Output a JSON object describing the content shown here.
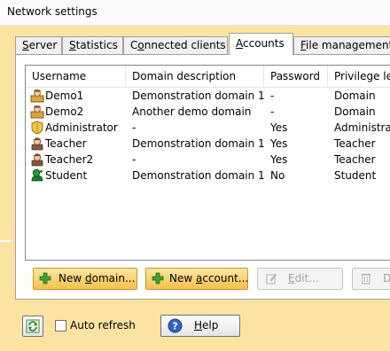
{
  "window": {
    "title": "Network settings"
  },
  "tabs": [
    {
      "label": "Server",
      "hotkey": "S",
      "rest": "erver"
    },
    {
      "label": "Statistics",
      "hotkey": "S",
      "rest": "tatistics"
    },
    {
      "label": "Connected clients",
      "pre": "C",
      "hotkey": "o",
      "rest": "nnected clients"
    },
    {
      "label": "Accounts",
      "hotkey": "A",
      "rest": "ccounts"
    },
    {
      "label": "File management",
      "hotkey": "F",
      "rest": "ile management"
    }
  ],
  "list": {
    "columns": [
      "Username",
      "Domain description",
      "Password",
      "Privilege lev"
    ],
    "rows": [
      {
        "icon": "user-domain-icon",
        "username": "Demo1",
        "domain": "Demonstration domain 1",
        "password": "-",
        "privilege": "Domain"
      },
      {
        "icon": "user-domain-icon",
        "username": "Demo2",
        "domain": "Another demo domain",
        "password": "-",
        "privilege": "Domain"
      },
      {
        "icon": "shield-admin-icon",
        "username": "Administrator",
        "domain": "-",
        "password": "Yes",
        "privilege": "Administrator"
      },
      {
        "icon": "teacher-icon",
        "username": "Teacher",
        "domain": "Demonstration domain 1",
        "password": "Yes",
        "privilege": "Teacher"
      },
      {
        "icon": "teacher-icon",
        "username": "Teacher2",
        "domain": "-",
        "password": "Yes",
        "privilege": "Teacher"
      },
      {
        "icon": "student-icon",
        "username": "Student",
        "domain": "Demonstration domain 1",
        "password": "No",
        "privilege": "Student"
      }
    ]
  },
  "buttons": {
    "new_domain": "New domain...",
    "new_domain_pre": "New ",
    "new_domain_hot": "d",
    "new_domain_rest": "omain...",
    "new_account": "New account...",
    "new_account_pre": "New ",
    "new_account_hot": "a",
    "new_account_rest": "ccount...",
    "edit": "Edit...",
    "edit_hot": "E",
    "edit_rest": "dit...",
    "delete": "D"
  },
  "footer": {
    "auto_refresh": "Auto refresh",
    "help": "Help",
    "help_hot": "H",
    "help_rest": "elp"
  },
  "colors": {
    "window_bg": "#fde3a2",
    "highlight_button": "#f7c04e",
    "add_icon": "#3aa531"
  }
}
